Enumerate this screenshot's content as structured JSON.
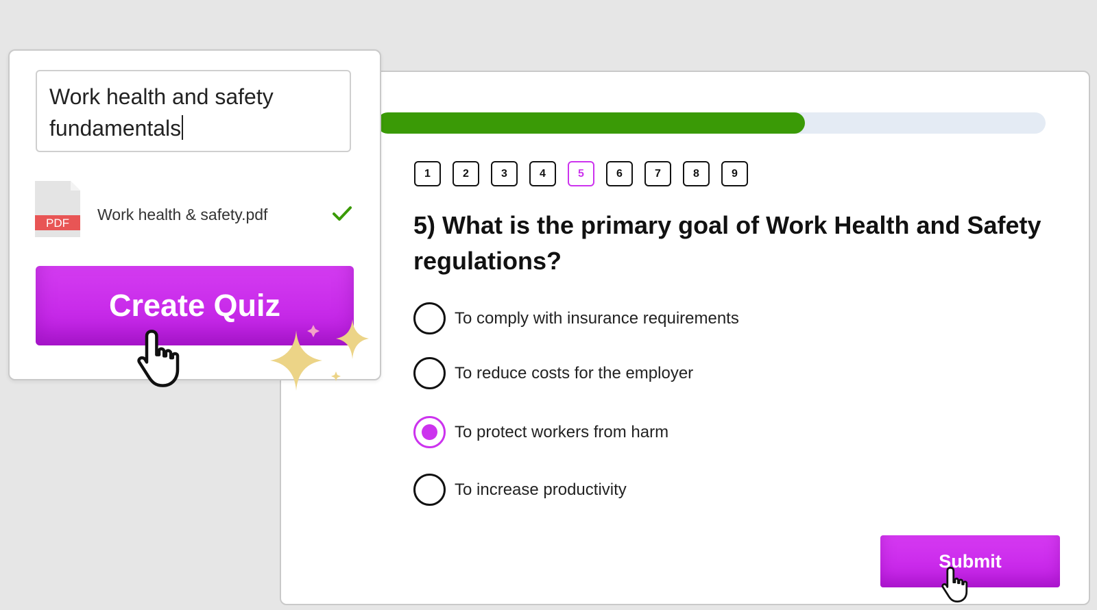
{
  "create_panel": {
    "topic_input": {
      "value": "Work health and safety fundamentals",
      "line1": "Work health and safety",
      "line2": "fundamentals"
    },
    "file": {
      "icon_label": "PDF",
      "name": "Work health & safety.pdf",
      "status_icon": "check-icon"
    },
    "create_button_label": "Create Quiz"
  },
  "quiz": {
    "progress_fraction": 0.64,
    "question_numbers": [
      "1",
      "2",
      "3",
      "4",
      "5",
      "6",
      "7",
      "8",
      "9"
    ],
    "current_question": "5",
    "question_text": "5) What is the primary goal of Work Health and Safety regulations?",
    "options": [
      {
        "label": "To comply with insurance requirements",
        "selected": false
      },
      {
        "label": "To reduce costs for the employer",
        "selected": false
      },
      {
        "label": "To protect workers from harm",
        "selected": true
      },
      {
        "label": "To increase productivity",
        "selected": false
      }
    ],
    "submit_label": "Submit"
  },
  "colors": {
    "accent": "#cc33ee",
    "progress": "#3a9a06",
    "progress_track": "#e4ebf4",
    "check": "#3a9a06",
    "pdf_badge": "#e85555",
    "sparkle": "#ecd487"
  }
}
